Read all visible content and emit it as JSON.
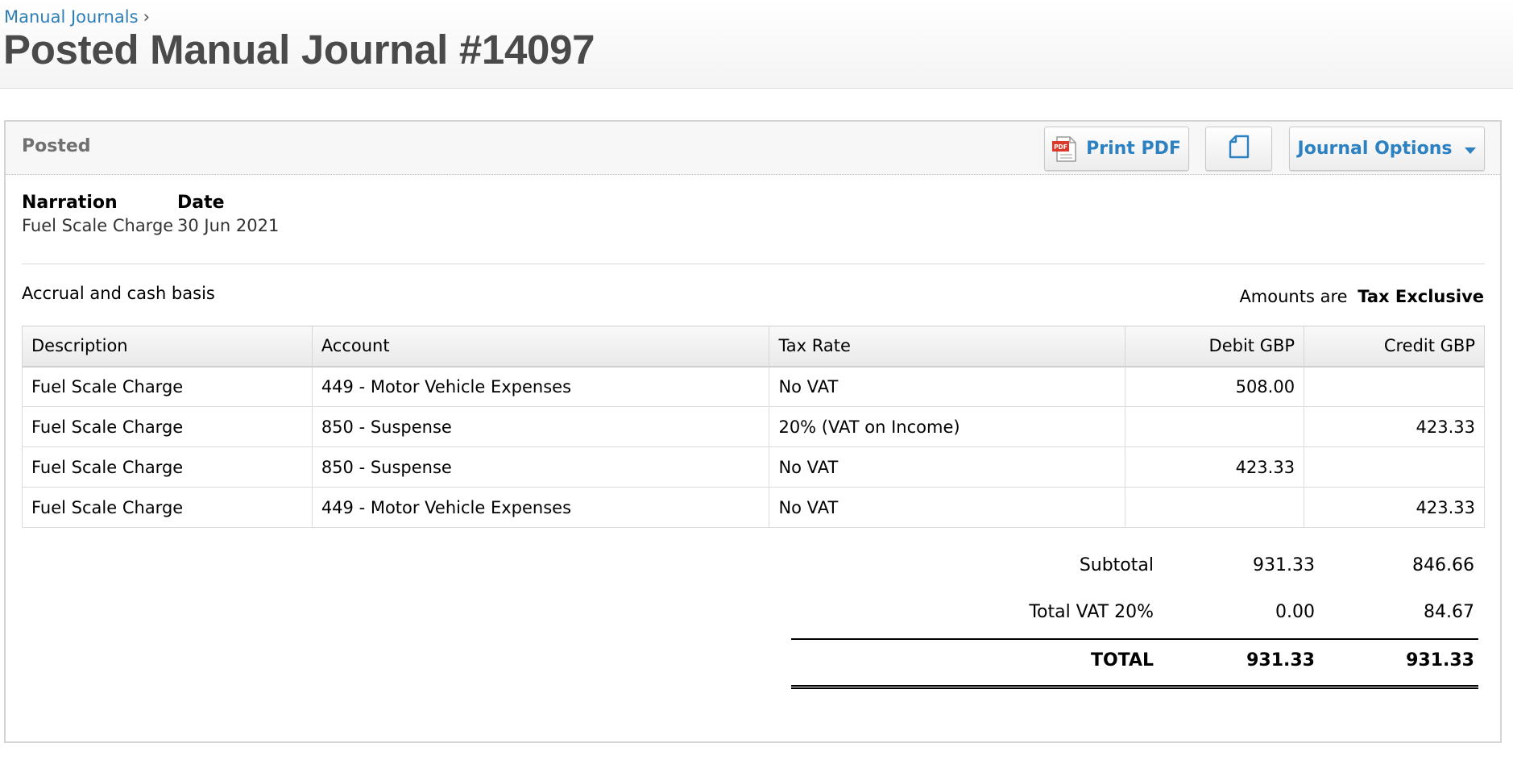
{
  "breadcrumb": {
    "link": "Manual Journals",
    "separator": "›"
  },
  "page_title": "Posted Manual Journal #14097",
  "panel": {
    "status": "Posted",
    "print_pdf_label": "Print PDF",
    "pdf_icon_text": "PDF",
    "journal_options_label": "Journal Options"
  },
  "meta": {
    "narration_label": "Narration",
    "narration_value": "Fuel Scale Charge",
    "date_label": "Date",
    "date_value": "30 Jun 2021"
  },
  "basis": "Accrual and cash basis",
  "amounts": {
    "prefix": "Amounts are",
    "value": "Tax Exclusive"
  },
  "table": {
    "headers": [
      "Description",
      "Account",
      "Tax Rate",
      "Debit GBP",
      "Credit GBP"
    ],
    "rows": [
      [
        "Fuel Scale Charge",
        "449 - Motor Vehicle Expenses",
        "No VAT",
        "508.00",
        ""
      ],
      [
        "Fuel Scale Charge",
        "850 - Suspense",
        "20% (VAT on Income)",
        "",
        "423.33"
      ],
      [
        "Fuel Scale Charge",
        "850 - Suspense",
        "No VAT",
        "423.33",
        ""
      ],
      [
        "Fuel Scale Charge",
        "449 - Motor Vehicle Expenses",
        "No VAT",
        "",
        "423.33"
      ]
    ]
  },
  "totals": {
    "subtotal": {
      "label": "Subtotal",
      "debit": "931.33",
      "credit": "846.66"
    },
    "vat": {
      "label": "Total VAT 20%",
      "debit": "0.00",
      "credit": "84.67"
    },
    "total": {
      "label": "TOTAL",
      "debit": "931.33",
      "credit": "931.33"
    }
  },
  "colors": {
    "link": "#2e7fb8",
    "button_text": "#2b81c1",
    "title": "#4a4a4a",
    "pdf_icon": "#d93a2b"
  },
  "icons": {
    "pdf": "pdf-icon",
    "copy": "copy-document-icon",
    "dropdown": "caret-down-icon"
  }
}
